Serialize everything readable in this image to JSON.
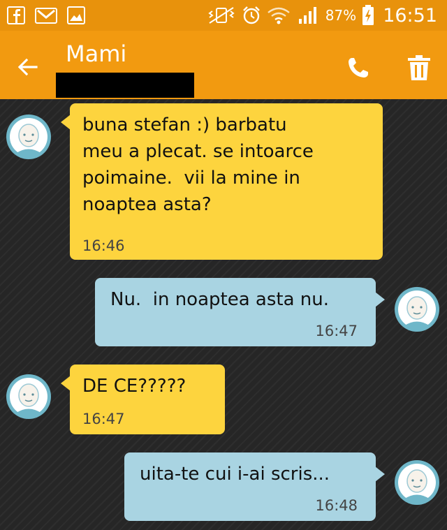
{
  "status_bar": {
    "icons": [
      "facebook-icon",
      "gmail-icon",
      "gallery-icon",
      "vibrate-icon",
      "alarm-icon",
      "wifi-icon",
      "signal-icon",
      "battery-charging-icon"
    ],
    "battery_percent": "87%",
    "time": "16:51"
  },
  "header": {
    "title": "Mami",
    "back_icon": "arrow-left-icon",
    "call_icon": "phone-icon",
    "delete_icon": "trash-icon"
  },
  "colors": {
    "status_bar": "#e8920c",
    "app_bar": "#f29a10",
    "incoming_bubble": "#fdd43e",
    "outgoing_bubble": "#a9d4e2",
    "background": "#262626"
  },
  "messages": [
    {
      "direction": "incoming",
      "text": "buna stefan :) barbatu\nmeu a plecat. se intoarce\npoimaine.  vii la mine in\nnoaptea asta?",
      "time": "16:46"
    },
    {
      "direction": "outgoing",
      "text": "Nu.  in noaptea asta nu.",
      "time": "16:47"
    },
    {
      "direction": "incoming",
      "text": "DE CE?????",
      "time": "16:47"
    },
    {
      "direction": "outgoing",
      "text": "uita-te cui i-ai scris...",
      "time": "16:48"
    }
  ]
}
